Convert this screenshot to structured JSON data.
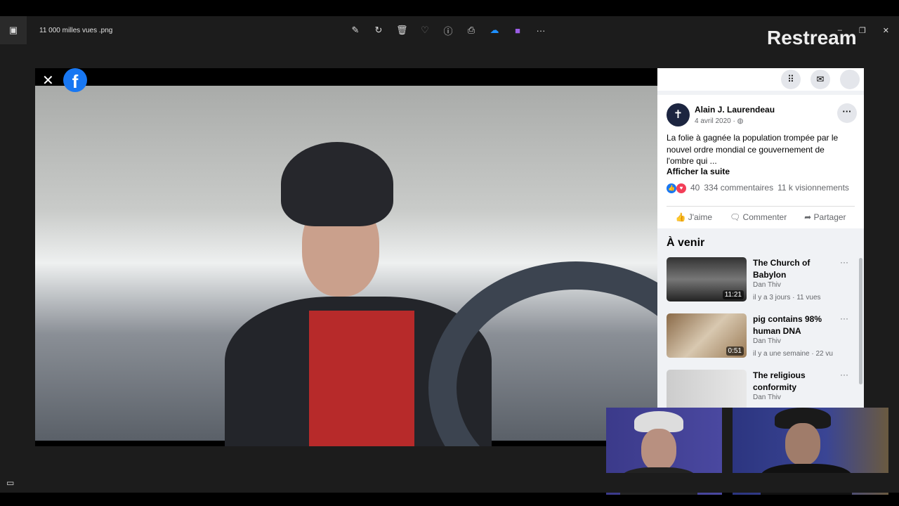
{
  "window": {
    "filename": "11 000 milles vues .png",
    "brand": "Restream",
    "toolbar_icons": [
      "edit-icon",
      "rotate-icon",
      "delete-icon",
      "favorite-icon",
      "info-icon",
      "print-icon",
      "onedrive-icon",
      "clipchamp-icon",
      "more-icon"
    ],
    "controls": {
      "minimize": "–",
      "maximize": "❐",
      "close": "✕"
    }
  },
  "video": {
    "close": "✕",
    "fb": "f"
  },
  "facebook": {
    "post": {
      "author": "Alain J. Laurendeau",
      "date": "4 avril 2020 · ◍",
      "text": "La folie à gagnée la population trompée par le nouvel ordre mondial ce gouvernement de l'ombre qui ...",
      "see_more": "Afficher la suite",
      "reactions": "40",
      "comments": "334 commentaires",
      "views": "11 k visionnements",
      "like": "J'aime",
      "comment": "Commenter",
      "share": "Partager"
    },
    "upcoming_title": "À venir",
    "videos": [
      {
        "title": "The Church of Babylon",
        "channel": "Dan Thiv",
        "meta": "il y a 3 jours · 11 vues",
        "duration": "11:21"
      },
      {
        "title": "pig contains 98% human DNA",
        "channel": "Dan Thiv",
        "meta": "il y a une semaine · 22 vu",
        "duration": "0:51"
      },
      {
        "title": "The religious conformity",
        "channel": "Dan Thiv",
        "meta": "",
        "duration": ""
      }
    ]
  }
}
